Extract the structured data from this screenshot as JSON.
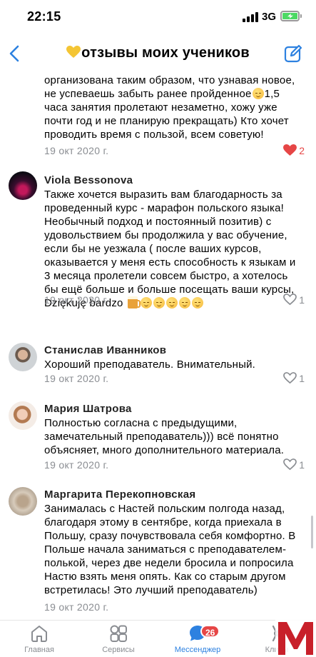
{
  "status": {
    "time": "22:15",
    "network": "3G"
  },
  "header": {
    "title": "отзывы моих учеников"
  },
  "messages": [
    {
      "author": "",
      "text_parts": [
        "организована таким образом, что узнавая новое, не успеваешь забыть ранее пройденное",
        "1,5 часа занятия пролетают незаметно, хожу уже почти год и не планирую прекращать) Кто хочет проводить время с пользой, всем советую!"
      ],
      "date": "19 окт 2020 г.",
      "likes": "2",
      "liked": true
    },
    {
      "author": "Viola Bessonova",
      "text": "Также хочется выразить вам благодарность за проведенный  курс - марафон польского языка! Необычный подход и постоянный позитив)  с удовольствием бы продолжила у вас обучение, если бы не уезжала ( после ваших курсов, оказывается у меня есть способность к языкам и 3 месяца пролетели совсем быстро,  а хотелось бы ещё больше и больше посещать ваши курсы,",
      "text_tail": "Dziękuję bardzo",
      "date": "19 окт 2020 г.",
      "likes": "1",
      "liked": false
    },
    {
      "author": "Станислав Иванников",
      "text": "Хороший преподаватель. Внимательный.",
      "date": "19 окт 2020 г.",
      "likes": "1",
      "liked": false
    },
    {
      "author": "Мария Шатрова",
      "text": "Полностью согласна с предыдущими, замечательный преподаватель))) всё понятно объясняет, много дополнительного материала.",
      "date": "19 окт 2020 г.",
      "likes": "1",
      "liked": false
    },
    {
      "author": "Маргарита Перекопновская",
      "text": "Занималась с Настей польским полгода назад, благодаря этому в сентябре, когда приехала в Польшу, сразу почувствовала себя комфортно. В Польше начала заниматься с преподавателем-полькой, через две недели бросила и попросила Настю взять меня опять. Как со старым другом встретилась! Это лучший преподаватель)",
      "date": "19 окт 2020 г.",
      "likes": "",
      "liked": false
    }
  ],
  "tabs": [
    {
      "label": "Главная",
      "icon": "home-icon"
    },
    {
      "label": "Сервисы",
      "icon": "grid-icon"
    },
    {
      "label": "Мессенджер",
      "icon": "chat-icon",
      "badge": "26",
      "active": true
    },
    {
      "label": "Клипы",
      "icon": "clips-icon"
    }
  ],
  "colors": {
    "accent": "#2d81e0",
    "like": "#e64646",
    "meta": "#8a8d92",
    "badge": "#e64646",
    "watermark": "#c8202a"
  }
}
